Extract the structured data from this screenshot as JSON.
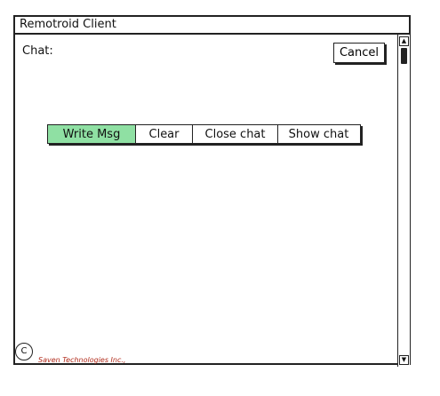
{
  "window": {
    "title": "Remotroid Client"
  },
  "chat": {
    "label": "Chat:"
  },
  "cancel_button": {
    "label": "Cancel"
  },
  "button_bar": {
    "items": [
      {
        "label": "Write Msg",
        "active": true
      },
      {
        "label": "Clear",
        "active": false
      },
      {
        "label": "Close chat",
        "active": false
      },
      {
        "label": "Show chat",
        "active": false
      }
    ]
  },
  "footer": {
    "copyright_symbol": "C",
    "company": "Saven Technologies Inc.,"
  },
  "colors": {
    "active_button": "#8fe0a3",
    "footer_text": "#b02a1a"
  }
}
